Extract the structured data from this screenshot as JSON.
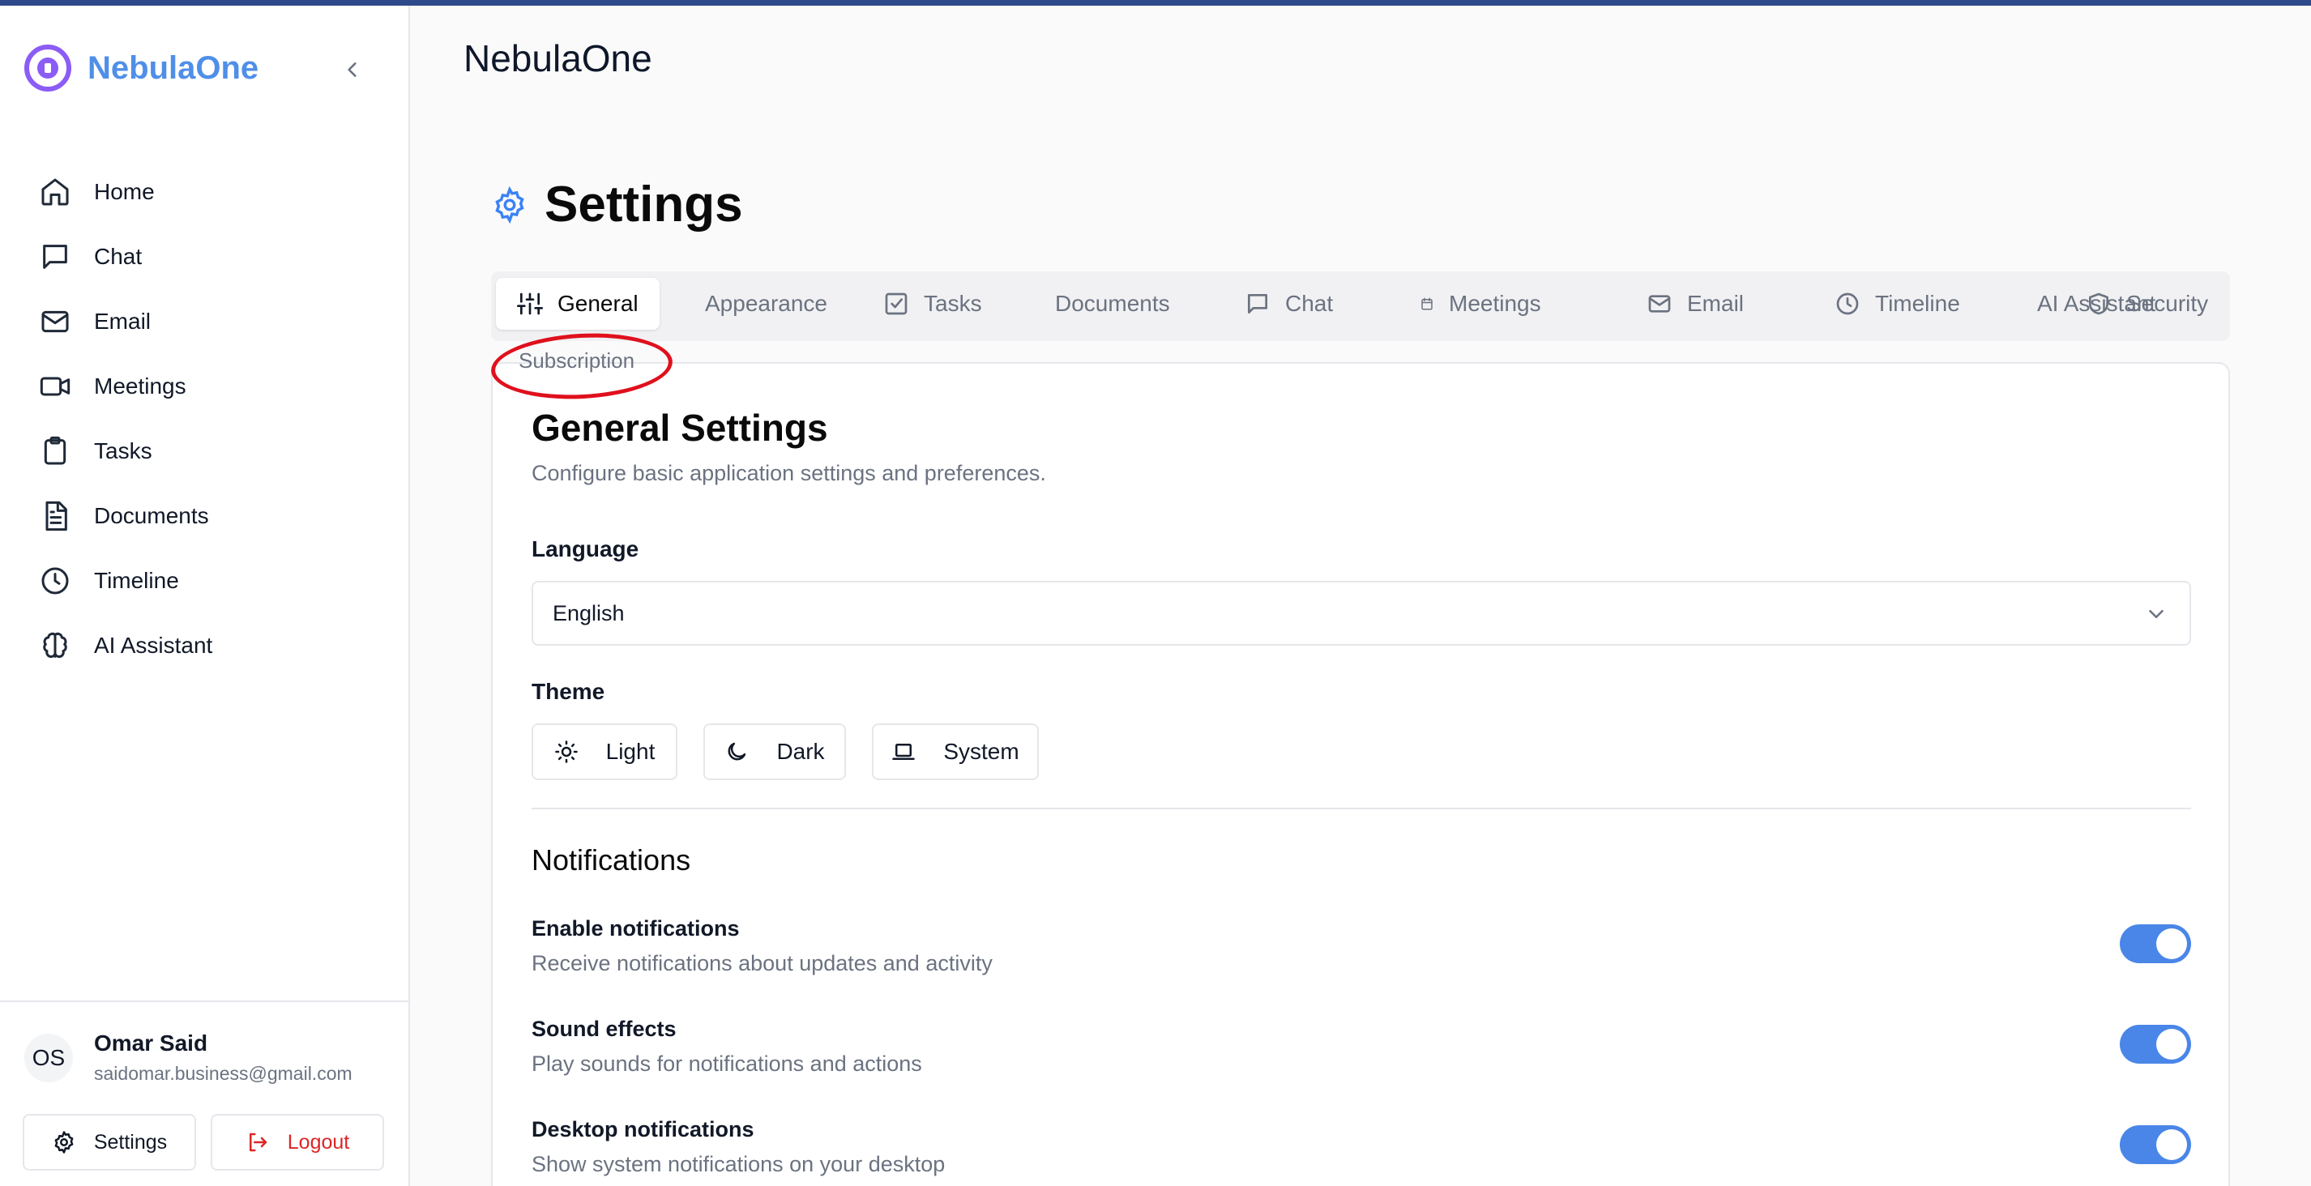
{
  "brand": {
    "name": "NebulaOne",
    "accent": "#4f8fe8",
    "logo_color": "#8b5cf6"
  },
  "sidebar": {
    "items": [
      {
        "label": "Home",
        "icon": "home-icon"
      },
      {
        "label": "Chat",
        "icon": "chat-icon"
      },
      {
        "label": "Email",
        "icon": "mail-icon"
      },
      {
        "label": "Meetings",
        "icon": "video-icon"
      },
      {
        "label": "Tasks",
        "icon": "clipboard-icon"
      },
      {
        "label": "Documents",
        "icon": "document-icon"
      },
      {
        "label": "Timeline",
        "icon": "clock-icon"
      },
      {
        "label": "AI Assistant",
        "icon": "brain-icon"
      }
    ],
    "user": {
      "initials": "OS",
      "name": "Omar Said",
      "email": "saidomar.business@gmail.com"
    },
    "settings_label": "Settings",
    "logout_label": "Logout"
  },
  "header": {
    "app_title": "NebulaOne",
    "page_title": "Settings"
  },
  "tabs": [
    {
      "label": "General",
      "icon": "sliders-icon",
      "active": true
    },
    {
      "label": "Appearance"
    },
    {
      "label": "Tasks",
      "icon": "checkbox-icon"
    },
    {
      "label": "Documents"
    },
    {
      "label": "Chat",
      "icon": "chat-icon"
    },
    {
      "label": "Meetings",
      "icon": "calendar-icon"
    },
    {
      "label": "Email",
      "icon": "mail-icon"
    },
    {
      "label": "Timeline",
      "icon": "clock-icon"
    },
    {
      "label": "AI Assistant"
    },
    {
      "label": "Security",
      "icon": "shield-icon"
    },
    {
      "label": "Subscription"
    }
  ],
  "general": {
    "title": "General Settings",
    "description": "Configure basic application settings and preferences.",
    "language_label": "Language",
    "language_value": "English",
    "theme_label": "Theme",
    "themes": [
      "Light",
      "Dark",
      "System"
    ],
    "notifications_heading": "Notifications",
    "notifications": [
      {
        "title": "Enable notifications",
        "desc": "Receive notifications about updates and activity",
        "enabled": true
      },
      {
        "title": "Sound effects",
        "desc": "Play sounds for notifications and actions",
        "enabled": true
      },
      {
        "title": "Desktop notifications",
        "desc": "Show system notifications on your desktop",
        "enabled": true
      }
    ]
  },
  "colors": {
    "toggle_on": "#4a86e8",
    "settings_icon": "#3b82f6",
    "logout": "#dc2626",
    "annotation": "#e0101d"
  }
}
